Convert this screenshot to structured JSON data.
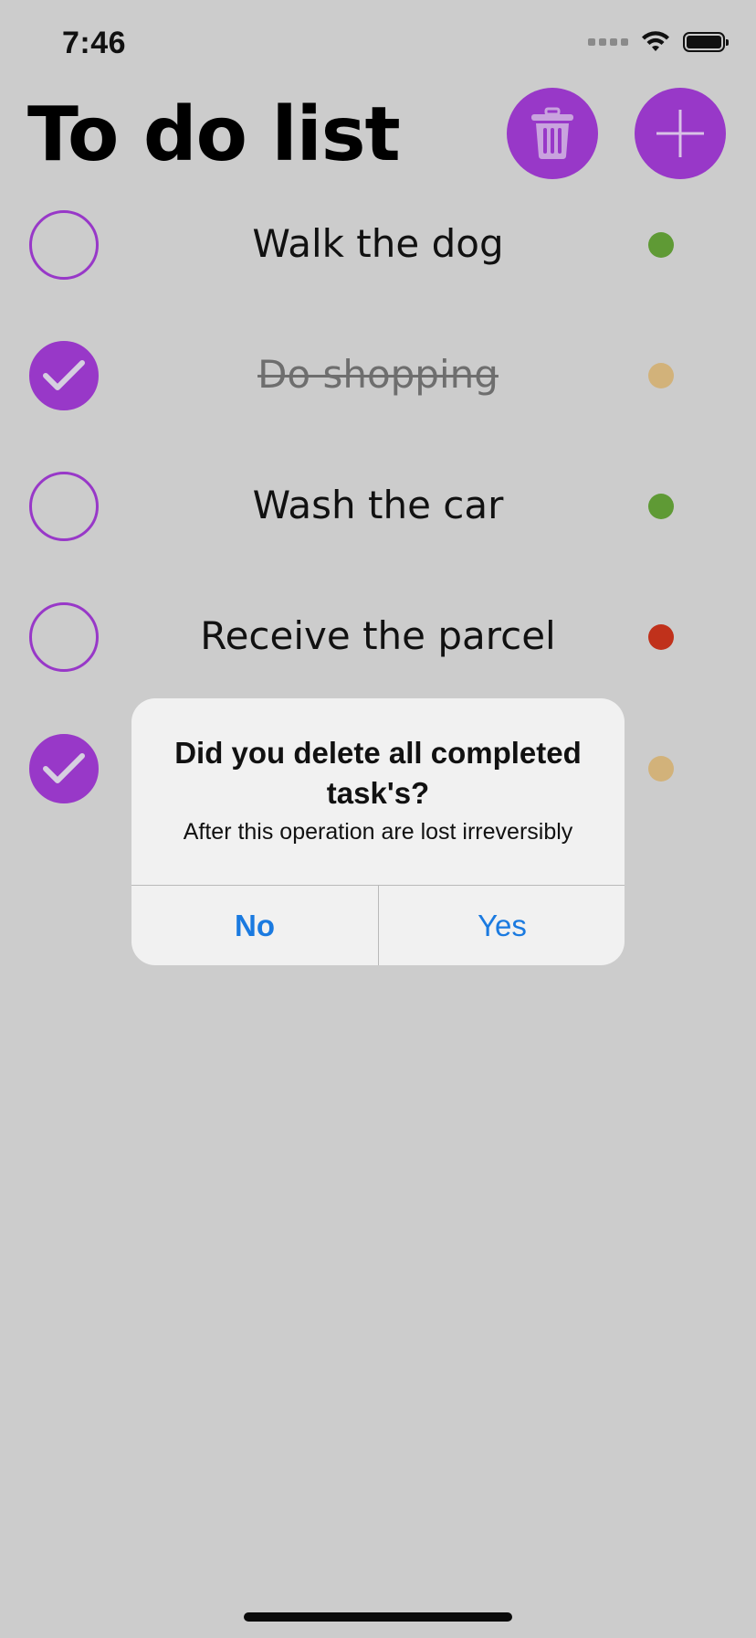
{
  "status_bar": {
    "time": "7:46"
  },
  "header": {
    "title": "To do list",
    "trash_icon": "trash-icon",
    "add_icon": "plus-icon"
  },
  "colors": {
    "accent": "#9838c8",
    "priority_low": "#5f9a35",
    "priority_medium": "#d2b27a",
    "priority_high": "#c0311b",
    "link_blue": "#1a7ae0"
  },
  "tasks": [
    {
      "label": "Walk the dog",
      "done": false,
      "priority_color": "#5f9a35"
    },
    {
      "label": "Do shopping",
      "done": true,
      "priority_color": "#d2b27a"
    },
    {
      "label": "Wash the car",
      "done": false,
      "priority_color": "#5f9a35"
    },
    {
      "label": "Receive the parcel",
      "done": false,
      "priority_color": "#c0311b"
    },
    {
      "label": "",
      "done": true,
      "priority_color": "#d2b27a"
    }
  ],
  "alert": {
    "title": "Did you delete all completed task's?",
    "message": "After this operation are lost irreversibly",
    "no_label": "No",
    "yes_label": "Yes"
  }
}
